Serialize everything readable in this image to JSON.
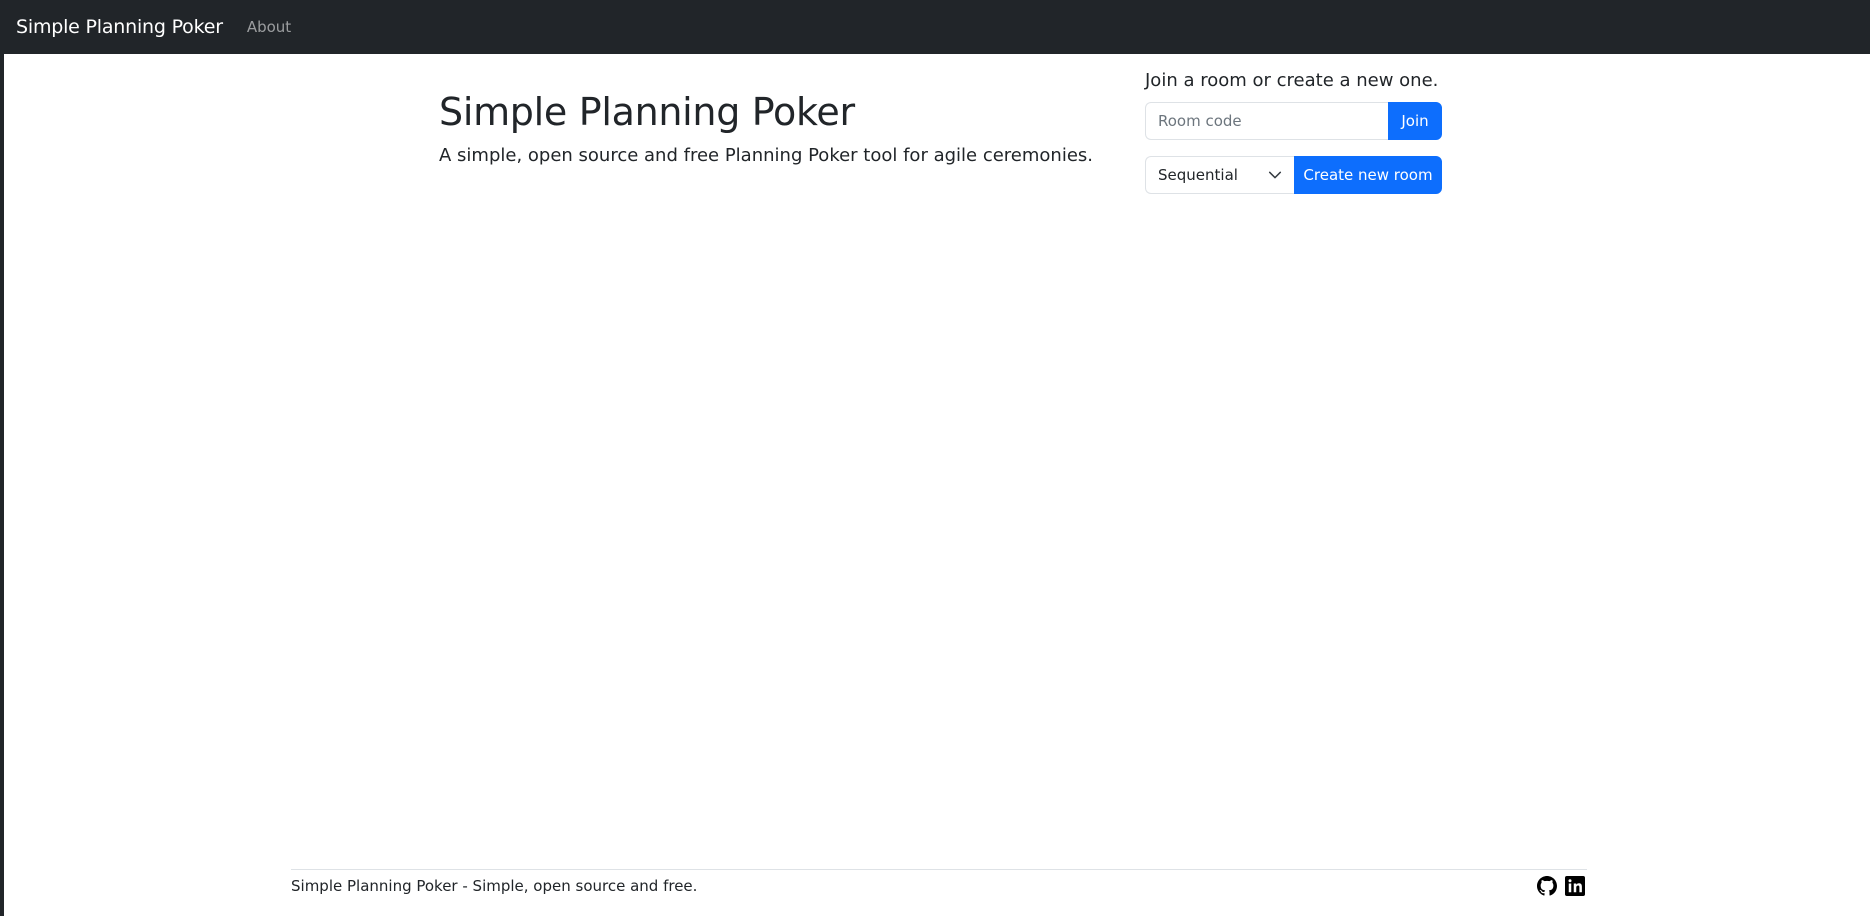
{
  "navbar": {
    "brand": "Simple Planning Poker",
    "links": [
      {
        "label": "About"
      }
    ]
  },
  "hero": {
    "title": "Simple Planning Poker",
    "subtitle": "A simple, open source and free Planning Poker tool for agile ceremonies."
  },
  "room_panel": {
    "heading": "Join a room or create a new one.",
    "room_code_placeholder": "Room code",
    "join_label": "Join",
    "deck_selected": "Sequential",
    "create_label": "Create new room"
  },
  "footer": {
    "text": "Simple Planning Poker - Simple, open source and free.",
    "icons": [
      "github-icon",
      "linkedin-icon"
    ]
  },
  "colors": {
    "navbar_bg": "#212529",
    "primary": "#0d6efd",
    "text": "#212529",
    "nav_link": "rgba(255,255,255,0.55)"
  }
}
